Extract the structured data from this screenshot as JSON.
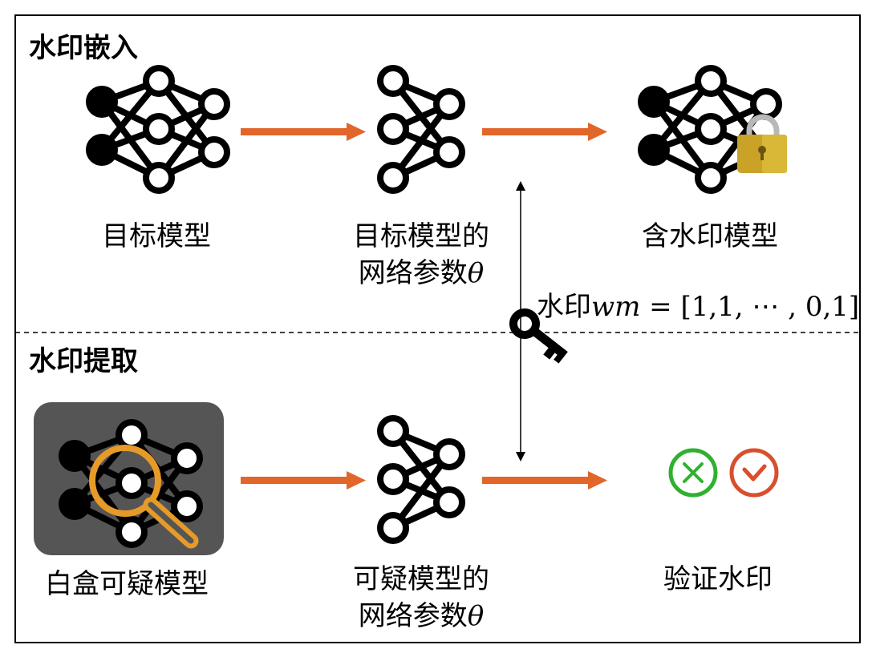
{
  "sections": {
    "embed": {
      "title": "水印嵌入"
    },
    "extract": {
      "title": "水印提取"
    }
  },
  "labels": {
    "target_model": "目标模型",
    "target_params_line1": "目标模型的",
    "target_params_line2_prefix": "网络参数",
    "theta": "θ",
    "watermarked_model": "含水印模型",
    "whitebox_model": "白盒可疑模型",
    "suspect_params_line1": "可疑模型的",
    "suspect_params_line2_prefix": "网络参数",
    "verify": "验证水印"
  },
  "watermark": {
    "prefix": "水印",
    "var": "wm",
    "equals": " = ",
    "value": "[1,1, ⋯ , 0,1]"
  },
  "icons": [
    "neural-network-icon",
    "neural-network-small-icon",
    "padlock-icon",
    "key-icon",
    "magnifier-icon",
    "cross-circle-icon",
    "check-circle-icon"
  ],
  "colors": {
    "arrow": "#e2662a",
    "lock_body": "#c9a227",
    "lock_shackle": "#b8b8b8",
    "suspect_bg": "#555555",
    "magnifier": "#e69a28",
    "cross": "#2fb12f",
    "check": "#d94f2d",
    "node_fill_input": "#000000"
  }
}
